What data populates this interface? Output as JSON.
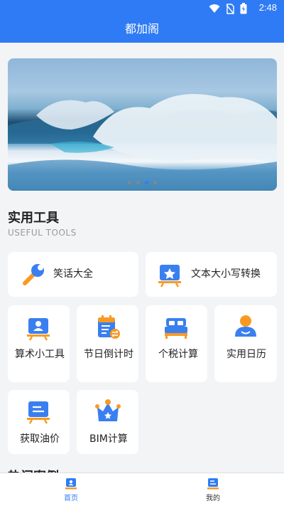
{
  "status_bar": {
    "time": "2:48"
  },
  "app_bar": {
    "title": "都加阁"
  },
  "banner": {
    "slides": 4,
    "active_index": 2
  },
  "section": {
    "title": "实用工具",
    "subtitle": "USEFUL TOOLS"
  },
  "tools": [
    {
      "label": "笑话大全",
      "icon": "wrench-icon"
    },
    {
      "label": "文本大小写转换",
      "icon": "presentation-star-icon"
    },
    {
      "label": "算术小工具",
      "icon": "presentation-user-icon"
    },
    {
      "label": "节日倒计时",
      "icon": "calendar-exchange-icon"
    },
    {
      "label": "个税计算",
      "icon": "bed-icon"
    },
    {
      "label": "实用日历",
      "icon": "user-icon"
    },
    {
      "label": "获取油价",
      "icon": "document-icon"
    },
    {
      "label": "BIM计算",
      "icon": "crown-icon"
    }
  ],
  "next_section": {
    "title": "热门案例"
  },
  "tabbar": {
    "home": "首页",
    "mine": "我的"
  },
  "colors": {
    "primary": "#2f7bf5",
    "icon_blue": "#3a7ff0",
    "icon_orange": "#f79a23"
  }
}
